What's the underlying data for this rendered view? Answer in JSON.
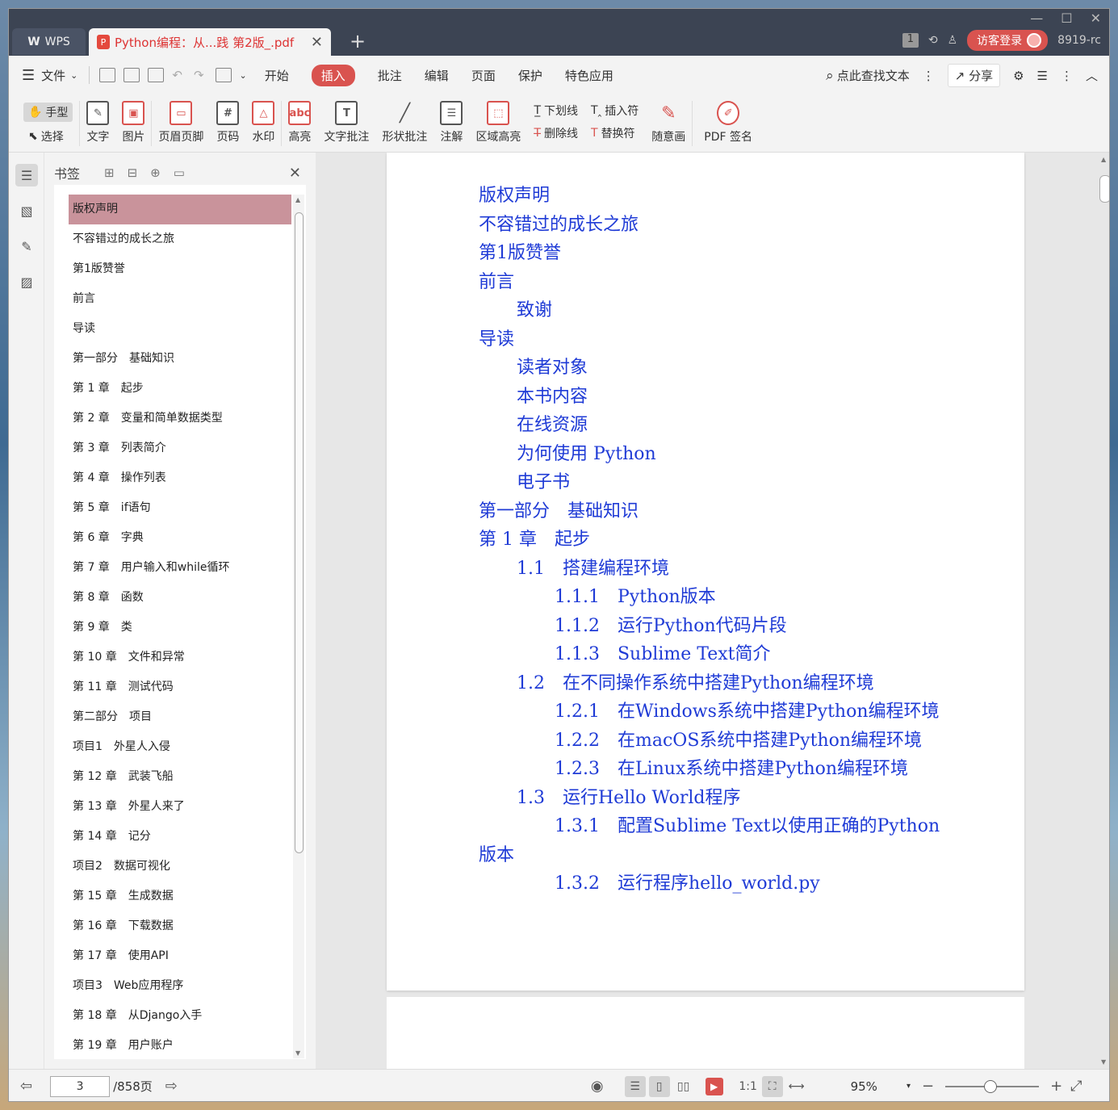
{
  "titlebar": {
    "wps_tab": "WPS",
    "doc_tab": "Python编程：从...践 第2版_.pdf",
    "pdf_icon_label": "P",
    "close_glyph": "✕",
    "add_glyph": "+",
    "badge": "1",
    "login": "访客登录",
    "version": "8919-rc"
  },
  "menubar": {
    "file": "文件",
    "items": [
      "开始",
      "插入",
      "批注",
      "编辑",
      "页面",
      "保护",
      "特色应用"
    ],
    "active_index": 1,
    "search": "点此查找文本",
    "share": "分享"
  },
  "ribbon": {
    "hand": "手型",
    "select": "选择",
    "text": "文字",
    "image": "图片",
    "header_footer": "页眉页脚",
    "page_num": "页码",
    "watermark": "水印",
    "highlight": "高亮",
    "text_annot": "文字批注",
    "shape_annot": "形状批注",
    "note": "注解",
    "area_highlight": "区域高亮",
    "underline": "下划线",
    "strikethrough": "删除线",
    "insert_mark": "插入符",
    "replace_mark": "替换符",
    "freehand": "随意画",
    "pdf_sign": "PDF 签名"
  },
  "bookmarks": {
    "title": "书签",
    "selected_index": 0,
    "items": [
      "版权声明",
      "不容错过的成长之旅",
      "第1版赞誉",
      "前言",
      "导读",
      "第一部分　基础知识",
      "第 1 章　起步",
      "第 2 章　变量和简单数据类型",
      "第 3 章　列表简介",
      "第 4 章　操作列表",
      "第 5 章　if语句",
      "第 6 章　字典",
      "第 7 章　用户输入和while循环",
      "第 8 章　函数",
      "第 9 章　类",
      "第 10 章　文件和异常",
      "第 11 章　测试代码",
      "第二部分　项目",
      "项目1　外星人入侵",
      "第 12 章　武装飞船",
      "第 13 章　外星人来了",
      "第 14 章　记分",
      "项目2　数据可视化",
      "第 15 章　生成数据",
      "第 16 章　下载数据",
      "第 17 章　使用API",
      "项目3　Web应用程序",
      "第 18 章　从Django入手",
      "第 19 章　用户账户"
    ]
  },
  "toc": [
    {
      "text": "版权声明",
      "level": 0
    },
    {
      "text": "不容错过的成长之旅",
      "level": 0
    },
    {
      "text": "第1版赞誉",
      "level": 0
    },
    {
      "text": "前言",
      "level": 0
    },
    {
      "text": "致谢",
      "level": 1
    },
    {
      "text": "导读",
      "level": 0
    },
    {
      "text": "读者对象",
      "level": 1
    },
    {
      "text": "本书内容",
      "level": 1
    },
    {
      "text": "在线资源",
      "level": 1
    },
    {
      "text": "为何使用 Python",
      "level": 1
    },
    {
      "text": "电子书",
      "level": 1
    },
    {
      "text": "第一部分　基础知识",
      "level": 0
    },
    {
      "text": "第 1 章　起步",
      "level": 0
    },
    {
      "text": "1.1　搭建编程环境",
      "level": 1
    },
    {
      "text": "1.1.1　Python版本",
      "level": 2
    },
    {
      "text": "1.1.2　运行Python代码片段",
      "level": 2
    },
    {
      "text": "1.1.3　Sublime Text简介",
      "level": 2
    },
    {
      "text": "1.2　在不同操作系统中搭建Python编程环境",
      "level": 1
    },
    {
      "text": "1.2.1　在Windows系统中搭建Python编程环境",
      "level": 2
    },
    {
      "text": "1.2.2　在macOS系统中搭建Python编程环境",
      "level": 2
    },
    {
      "text": "1.2.3　在Linux系统中搭建Python编程环境",
      "level": 2
    },
    {
      "text": "1.3　运行Hello World程序",
      "level": 1
    },
    {
      "text": "1.3.1　配置Sublime Text以使用正确的Python",
      "level": 2
    },
    {
      "text": "版本",
      "level": 0
    },
    {
      "text": "1.3.2　运行程序hello_world.py",
      "level": 2
    }
  ],
  "statusbar": {
    "current_page": "3",
    "total": "/858页",
    "zoom": "95%"
  },
  "colors": {
    "accent": "#d9534f",
    "toc_link": "#1f3bd6",
    "bookmark_selected": "#c9939b"
  }
}
